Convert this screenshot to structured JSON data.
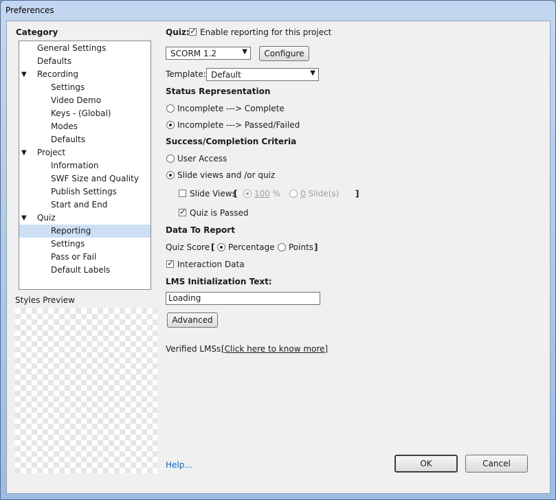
{
  "window": {
    "title": "Preferences"
  },
  "sidebar": {
    "category_label": "Category",
    "tree": [
      {
        "label": "General Settings",
        "level": 0
      },
      {
        "label": "Defaults",
        "level": 0
      },
      {
        "label": "Recording",
        "level": 0,
        "expander": "▼"
      },
      {
        "label": "Settings",
        "level": 1
      },
      {
        "label": "Video Demo",
        "level": 1
      },
      {
        "label": "Keys - (Global)",
        "level": 1
      },
      {
        "label": "Modes",
        "level": 1
      },
      {
        "label": "Defaults",
        "level": 1
      },
      {
        "label": "Project",
        "level": 0,
        "expander": "▼"
      },
      {
        "label": "Information",
        "level": 1
      },
      {
        "label": "SWF Size and Quality",
        "level": 1
      },
      {
        "label": "Publish Settings",
        "level": 1
      },
      {
        "label": "Start and End",
        "level": 1
      },
      {
        "label": "Quiz",
        "level": 0,
        "expander": "▼"
      },
      {
        "label": "Reporting",
        "level": 1,
        "selected": true
      },
      {
        "label": "Settings",
        "level": 1
      },
      {
        "label": "Pass or Fail",
        "level": 1
      },
      {
        "label": "Default Labels",
        "level": 1
      }
    ],
    "styles_preview_label": "Styles Preview"
  },
  "main": {
    "quiz_label": "Quiz:",
    "enable_reporting_label": "Enable reporting for this project",
    "lms_standard": "SCORM 1.2",
    "configure_label": "Configure",
    "template_label": "Template:",
    "template_value": "Default",
    "status_heading": "Status Representation",
    "status_opt1": "Incomplete ---> Complete",
    "status_opt2": "Incomplete ---> Passed/Failed",
    "criteria_heading": "Success/Completion Criteria",
    "user_access_label": "User Access",
    "slide_views_quiz_label": "Slide views and /or quiz",
    "slide_views_label": "Slide Views",
    "bracket_open": "[",
    "bracket_close": "]",
    "percent_value": "100",
    "percent_unit": " %",
    "slides_value": "0",
    "slides_unit": " Slide(s)",
    "quiz_passed_label": "Quiz is Passed",
    "data_heading": "Data To Report",
    "quiz_score_label": "Quiz Score",
    "percentage_label": "Percentage",
    "points_label": "Points",
    "interaction_label": "Interaction Data",
    "lms_text_heading": "LMS Initialization Text:",
    "lms_text_value": "Loading",
    "advanced_label": "Advanced",
    "verified_label": "Verified LMSs:",
    "verified_link": "[Click here to know more]"
  },
  "footer": {
    "help_label": "Help...",
    "ok_label": "OK",
    "cancel_label": "Cancel"
  },
  "icons": {
    "dropdown": "chevron-down-icon",
    "tree_expander": "triangle-down-icon",
    "check": "check-icon"
  }
}
